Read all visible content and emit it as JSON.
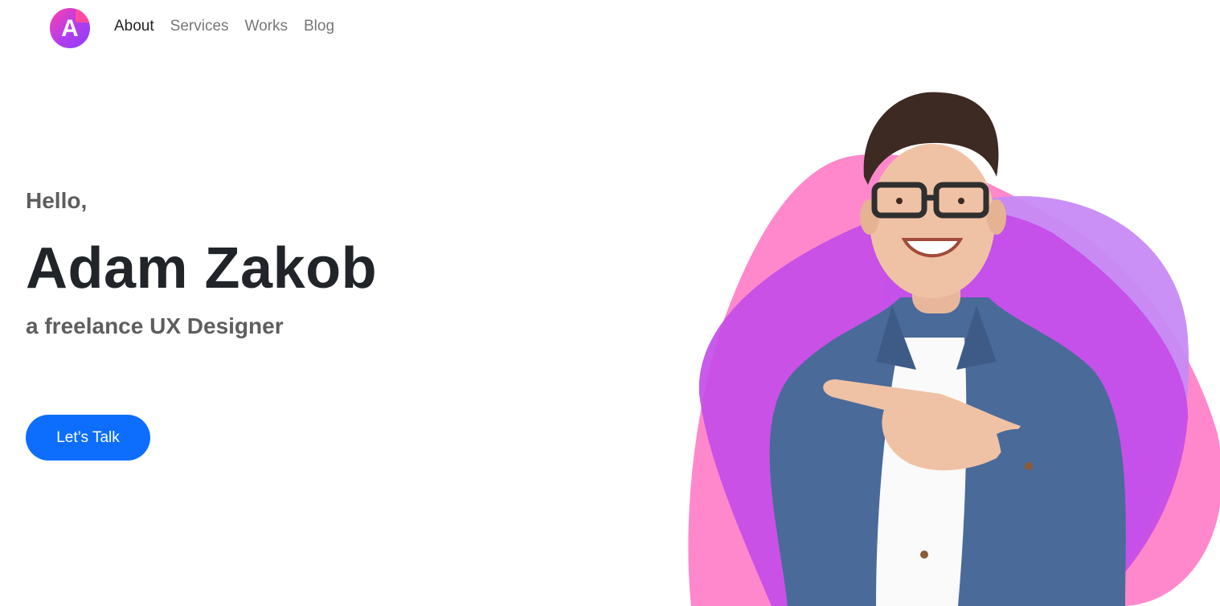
{
  "brand": {
    "logo_letter": "A",
    "colors": {
      "logo_gradient_start": "#ff3fa8",
      "logo_gradient_end": "#8b3df2"
    }
  },
  "nav": {
    "items": [
      {
        "label": "About",
        "active": true
      },
      {
        "label": "Services",
        "active": false
      },
      {
        "label": "Works",
        "active": false
      },
      {
        "label": "Blog",
        "active": false
      }
    ]
  },
  "hero": {
    "greeting": "Hello,",
    "name": "Adam Zakob",
    "tagline": "a freelance UX Designer",
    "cta_label": "Let’s Talk",
    "colors": {
      "cta": "#0d6efd",
      "blob_pink": "#ff88cc",
      "blob_purple": "#c44ce8",
      "blob_light_purple": "#c78af5"
    },
    "portrait": "man in glasses and denim shirt pointing left"
  }
}
